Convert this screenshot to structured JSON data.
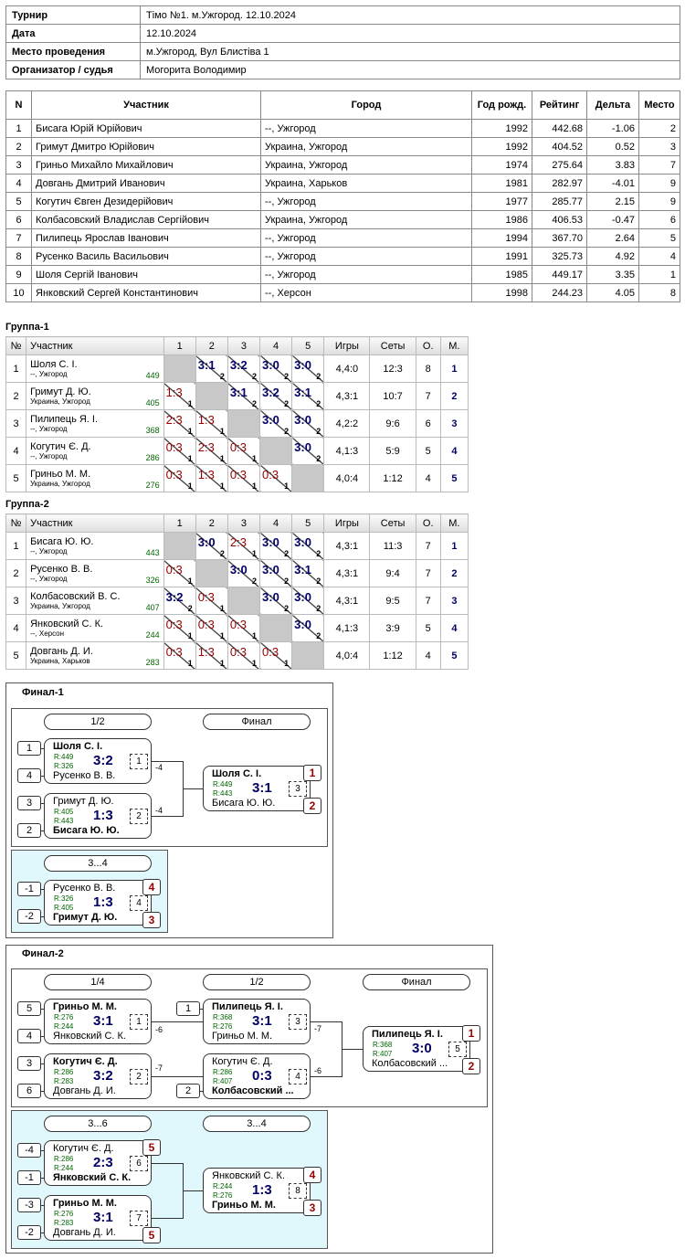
{
  "info": [
    {
      "k": "Турнир",
      "v": "Тімо №1. м.Ужгород. 12.10.2024"
    },
    {
      "k": "Дата",
      "v": "12.10.2024"
    },
    {
      "k": "Место проведения",
      "v": "м.Ужгород, Вул Блистіва 1"
    },
    {
      "k": "Организатор / судья",
      "v": "Могорита Володимир"
    }
  ],
  "plist": {
    "headers": [
      "N",
      "Участник",
      "Город",
      "Год рожд.",
      "Рейтинг",
      "Дельта",
      "Место"
    ],
    "rows": [
      [
        "1",
        "Бисага Юрій Юрійович",
        "--, Ужгород",
        "1992",
        "442.68",
        "-1.06",
        "2"
      ],
      [
        "2",
        "Гримут Дмитро Юрійович",
        "Украина, Ужгород",
        "1992",
        "404.52",
        "0.52",
        "3"
      ],
      [
        "3",
        "Гриньо Михайло Михайлович",
        "Украина, Ужгород",
        "1974",
        "275.64",
        "3.83",
        "7"
      ],
      [
        "4",
        "Довгань Дмитрий Иванович",
        "Украина, Харьков",
        "1981",
        "282.97",
        "-4.01",
        "9"
      ],
      [
        "5",
        "Когутич Євген Дезидерійович",
        "--, Ужгород",
        "1977",
        "285.77",
        "2.15",
        "9"
      ],
      [
        "6",
        "Колбасовский Владислав Сергійович",
        "Украина, Ужгород",
        "1986",
        "406.53",
        "-0.47",
        "6"
      ],
      [
        "7",
        "Пилипець Ярослав Іванович",
        "--, Ужгород",
        "1994",
        "367.70",
        "2.64",
        "5"
      ],
      [
        "8",
        "Русенко Василь Васильович",
        "--, Ужгород",
        "1991",
        "325.73",
        "4.92",
        "4"
      ],
      [
        "9",
        "Шоля Сергій Іванович",
        "--, Ужгород",
        "1985",
        "449.17",
        "3.35",
        "1"
      ],
      [
        "10",
        "Янковский Сергей Константинович",
        "--, Херсон",
        "1998",
        "244.23",
        "4.05",
        "8"
      ]
    ]
  },
  "group_headers": [
    "№",
    "Участник",
    "1",
    "2",
    "3",
    "4",
    "5",
    "Игры",
    "Сеты",
    "О.",
    "М."
  ],
  "groups": [
    {
      "title": "Группа-1",
      "rows": [
        {
          "n": "1",
          "name": "Шоля С. І.",
          "city": "--, Ужгород",
          "rating": "449",
          "scores": [
            null,
            [
              "3:1",
              "2",
              "w"
            ],
            [
              "3:2",
              "2",
              "w"
            ],
            [
              "3:0",
              "2",
              "w"
            ],
            [
              "3:0",
              "2",
              "w"
            ]
          ],
          "games": "4,4:0",
          "sets": "12:3",
          "pts": "8",
          "place": "1"
        },
        {
          "n": "2",
          "name": "Гримут Д. Ю.",
          "city": "Украина, Ужгород",
          "rating": "405",
          "scores": [
            [
              "1:3",
              "1",
              "l"
            ],
            null,
            [
              "3:1",
              "2",
              "w"
            ],
            [
              "3:2",
              "2",
              "w"
            ],
            [
              "3:1",
              "2",
              "w"
            ]
          ],
          "games": "4,3:1",
          "sets": "10:7",
          "pts": "7",
          "place": "2"
        },
        {
          "n": "3",
          "name": "Пилипець Я. І.",
          "city": "--, Ужгород",
          "rating": "368",
          "scores": [
            [
              "2:3",
              "1",
              "l"
            ],
            [
              "1:3",
              "1",
              "l"
            ],
            null,
            [
              "3:0",
              "2",
              "w"
            ],
            [
              "3:0",
              "2",
              "w"
            ]
          ],
          "games": "4,2:2",
          "sets": "9:6",
          "pts": "6",
          "place": "3"
        },
        {
          "n": "4",
          "name": "Когутич Є. Д.",
          "city": "--, Ужгород",
          "rating": "286",
          "scores": [
            [
              "0:3",
              "1",
              "l"
            ],
            [
              "2:3",
              "1",
              "l"
            ],
            [
              "0:3",
              "1",
              "l"
            ],
            null,
            [
              "3:0",
              "2",
              "w"
            ]
          ],
          "games": "4,1:3",
          "sets": "5:9",
          "pts": "5",
          "place": "4"
        },
        {
          "n": "5",
          "name": "Гриньо М. М.",
          "city": "Украина, Ужгород",
          "rating": "276",
          "scores": [
            [
              "0:3",
              "1",
              "l"
            ],
            [
              "1:3",
              "1",
              "l"
            ],
            [
              "0:3",
              "1",
              "l"
            ],
            [
              "0:3",
              "1",
              "l"
            ],
            null
          ],
          "games": "4,0:4",
          "sets": "1:12",
          "pts": "4",
          "place": "5"
        }
      ]
    },
    {
      "title": "Группа-2",
      "rows": [
        {
          "n": "1",
          "name": "Бисага Ю. Ю.",
          "city": "--, Ужгород",
          "rating": "443",
          "scores": [
            null,
            [
              "3:0",
              "2",
              "w"
            ],
            [
              "2:3",
              "1",
              "l"
            ],
            [
              "3:0",
              "2",
              "w"
            ],
            [
              "3:0",
              "2",
              "w"
            ]
          ],
          "games": "4,3:1",
          "sets": "11:3",
          "pts": "7",
          "place": "1"
        },
        {
          "n": "2",
          "name": "Русенко В. В.",
          "city": "--, Ужгород",
          "rating": "326",
          "scores": [
            [
              "0:3",
              "1",
              "l"
            ],
            null,
            [
              "3:0",
              "2",
              "w"
            ],
            [
              "3:0",
              "2",
              "w"
            ],
            [
              "3:1",
              "2",
              "w"
            ]
          ],
          "games": "4,3:1",
          "sets": "9:4",
          "pts": "7",
          "place": "2"
        },
        {
          "n": "3",
          "name": "Колбасовский В. С.",
          "city": "Украина, Ужгород",
          "rating": "407",
          "scores": [
            [
              "3:2",
              "2",
              "w"
            ],
            [
              "0:3",
              "1",
              "l"
            ],
            null,
            [
              "3:0",
              "2",
              "w"
            ],
            [
              "3:0",
              "2",
              "w"
            ]
          ],
          "games": "4,3:1",
          "sets": "9:5",
          "pts": "7",
          "place": "3"
        },
        {
          "n": "4",
          "name": "Янковский С. К.",
          "city": "--, Херсон",
          "rating": "244",
          "scores": [
            [
              "0:3",
              "1",
              "l"
            ],
            [
              "0:3",
              "1",
              "l"
            ],
            [
              "0:3",
              "1",
              "l"
            ],
            null,
            [
              "3:0",
              "2",
              "w"
            ]
          ],
          "games": "4,1:3",
          "sets": "3:9",
          "pts": "5",
          "place": "4"
        },
        {
          "n": "5",
          "name": "Довгань Д. И.",
          "city": "Украина, Харьков",
          "rating": "283",
          "scores": [
            [
              "0:3",
              "1",
              "l"
            ],
            [
              "1:3",
              "1",
              "l"
            ],
            [
              "0:3",
              "1",
              "l"
            ],
            [
              "0:3",
              "1",
              "l"
            ],
            null
          ],
          "games": "4,0:4",
          "sets": "1:12",
          "pts": "4",
          "place": "5"
        }
      ]
    }
  ],
  "final1": {
    "title": "Финал-1",
    "labels": {
      "semi": "1/2",
      "final": "Финал",
      "third": "3...4"
    },
    "seeds": [
      "1",
      "4",
      "3",
      "2",
      "-1",
      "-2"
    ],
    "m1": {
      "p1": "Шоля С. І.",
      "p2": "Русенко В. В.",
      "r1": "R:449",
      "r2": "R:326",
      "score": "3:2",
      "num": "1",
      "loser": "-4"
    },
    "m2": {
      "p1": "Гримут Д. Ю.",
      "p2": "Бисага Ю. Ю.",
      "r1": "R:405",
      "r2": "R:443",
      "score": "1:3",
      "num": "2",
      "loser": "-4"
    },
    "mf": {
      "p1": "Шоля С. І.",
      "p2": "Бисага Ю. Ю.",
      "r1": "R:449",
      "r2": "R:443",
      "score": "3:1",
      "num": "3",
      "place1": "1",
      "place2": "2"
    },
    "m3": {
      "p1": "Русенко В. В.",
      "p2": "Гримут Д. Ю.",
      "r1": "R:326",
      "r2": "R:405",
      "score": "1:3",
      "num": "4",
      "place1": "4",
      "place2": "3"
    }
  },
  "final2": {
    "title": "Финал-2",
    "labels": {
      "q": "1/4",
      "semi": "1/2",
      "final": "Финал",
      "l36": "3...6",
      "l34": "3...4"
    },
    "seeds": [
      "5",
      "4",
      "3",
      "6",
      "1",
      "2",
      "-4",
      "-1",
      "-3",
      "-2"
    ],
    "q1": {
      "p1": "Гриньо М. М.",
      "p2": "Янковский С. К.",
      "r1": "R:276",
      "r2": "R:244",
      "score": "3:1",
      "num": "1",
      "loser": "-6"
    },
    "q2": {
      "p1": "Когутич Є. Д.",
      "p2": "Довгань Д. И.",
      "r1": "R:286",
      "r2": "R:283",
      "score": "3:2",
      "num": "2",
      "loser": "-7"
    },
    "s1": {
      "p1": "Пилипець Я. І.",
      "p2": "Гриньо М. М.",
      "r1": "R:368",
      "r2": "R:276",
      "score": "3:1",
      "num": "3",
      "loser": "-7"
    },
    "s2": {
      "p1": "Когутич Є. Д.",
      "p2": "Колбасовский ...",
      "r1": "R:286",
      "r2": "R:407",
      "score": "0:3",
      "num": "4",
      "loser": "-6"
    },
    "f": {
      "p1": "Пилипець Я. І.",
      "p2": "Колбасовский ...",
      "r1": "R:368",
      "r2": "R:407",
      "score": "3:0",
      "num": "5",
      "place1": "1",
      "place2": "2"
    },
    "c1": {
      "p1": "Когутич Є. Д.",
      "p2": "Янковский С. К.",
      "r1": "R:286",
      "r2": "R:244",
      "score": "2:3",
      "num": "6",
      "place1": "5"
    },
    "c2": {
      "p1": "Гриньо М. М.",
      "p2": "Довгань Д. И.",
      "r1": "R:276",
      "r2": "R:283",
      "score": "3:1",
      "num": "7",
      "place2": "5"
    },
    "c3": {
      "p1": "Янковский С. К.",
      "p2": "Гриньо М. М.",
      "r1": "R:244",
      "r2": "R:276",
      "score": "1:3",
      "num": "8",
      "place1": "4",
      "place2": "3"
    }
  }
}
